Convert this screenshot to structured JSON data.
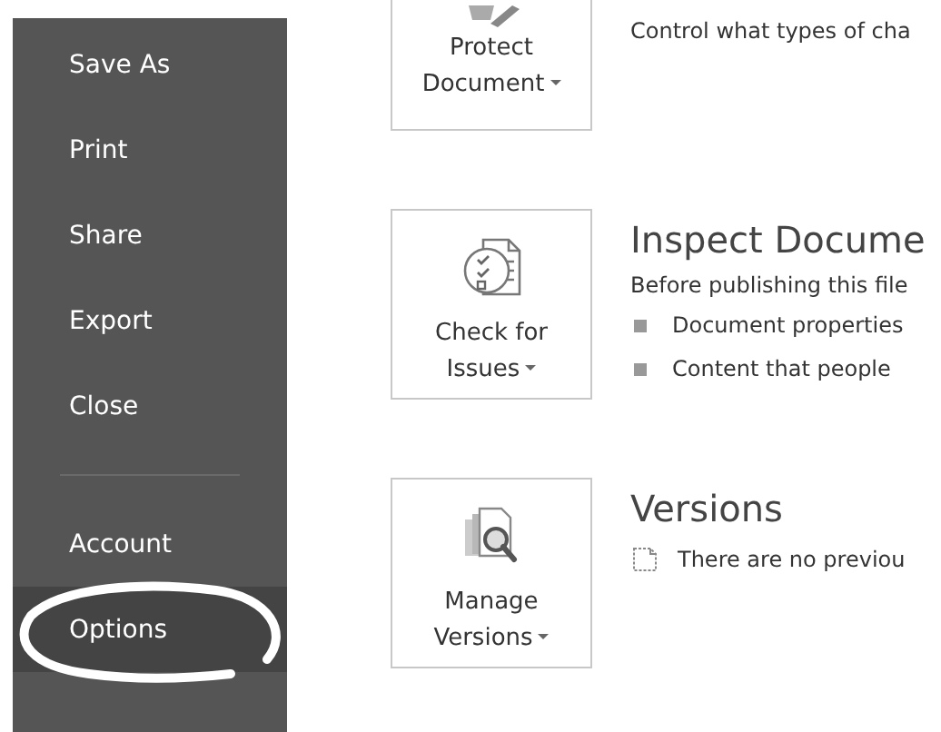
{
  "sidebar": {
    "items": [
      {
        "label": "Save As",
        "selected": false,
        "circled": false
      },
      {
        "label": "Print",
        "selected": false,
        "circled": false
      },
      {
        "label": "Share",
        "selected": false,
        "circled": false
      },
      {
        "label": "Export",
        "selected": false,
        "circled": false
      },
      {
        "label": "Close",
        "selected": false,
        "circled": false
      }
    ],
    "bottom_items": [
      {
        "label": "Account",
        "selected": false,
        "circled": false
      },
      {
        "label": "Options",
        "selected": true,
        "circled": true
      }
    ]
  },
  "sections": [
    {
      "kind": "protect",
      "button": "Protect Document",
      "description": "Control what types of cha"
    },
    {
      "kind": "inspect",
      "button": "Check for Issues",
      "title": "Inspect Docume",
      "description": "Before publishing this file",
      "bullets": [
        "Document properties",
        "Content that people"
      ]
    },
    {
      "kind": "versions",
      "button": "Manage Versions",
      "title": "Versions",
      "note": "There are no previou"
    }
  ]
}
